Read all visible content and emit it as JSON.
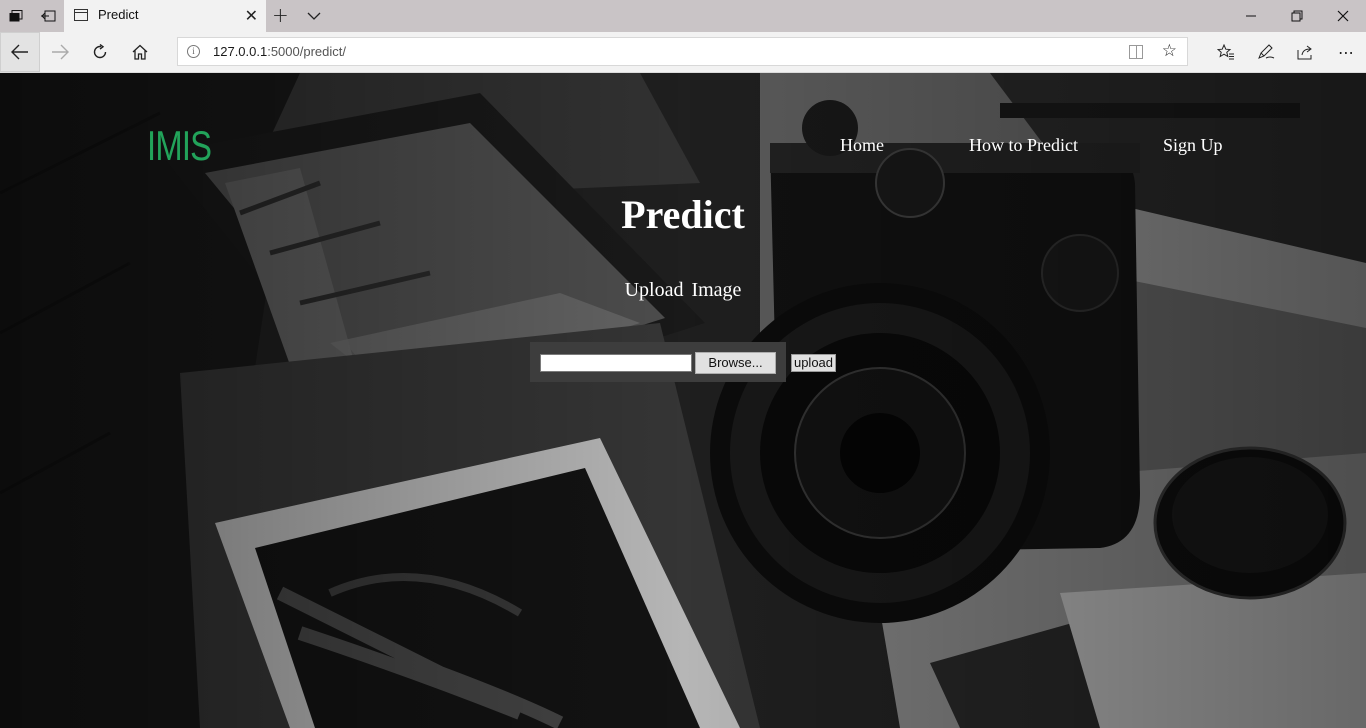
{
  "browser": {
    "tab_title": "Predict",
    "url_host": "127.0.0.1",
    "url_rest": ":5000/predict/",
    "icons": {
      "tab_actions_1": "tab-set-aside-icon",
      "tab_actions_2": "tab-preview-icon",
      "new_tab": "plus-icon",
      "tab_list": "chevron-down-icon",
      "back": "back-arrow-icon",
      "forward": "forward-arrow-icon",
      "refresh": "refresh-icon",
      "home": "home-icon",
      "info": "info-icon",
      "reading_view": "reading-view-icon",
      "favorite": "star-icon",
      "favorites_bar": "favorites-list-icon",
      "notes": "pen-icon",
      "share": "share-icon",
      "more": "more-icon"
    }
  },
  "site": {
    "logo": "IMIS",
    "logo_color": "#22a35a",
    "nav": [
      {
        "label": "Home"
      },
      {
        "label": "How to Predict"
      },
      {
        "label": "Sign Up"
      }
    ],
    "heading": "Predict",
    "subheading": "Upload Image",
    "form": {
      "file_value": "",
      "browse_label": "Browse...",
      "submit_label": "upload"
    }
  }
}
